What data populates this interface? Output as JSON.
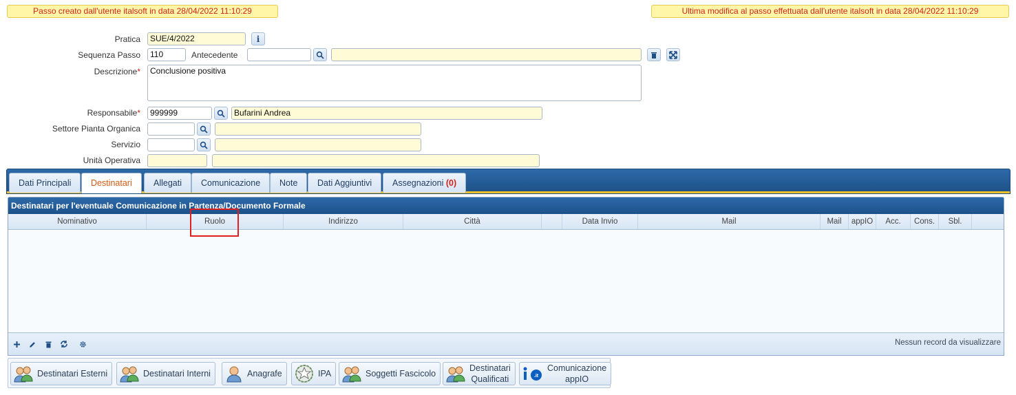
{
  "banners": {
    "created": "Passo creato dall'utente italsoft in data 28/04/2022 11:10:29",
    "modified": "Ultima modifica al passo effettuata dall'utente italsoft in data 28/04/2022 11:10:29"
  },
  "form": {
    "pratica_label": "Pratica",
    "pratica_value": "SUE/4/2022",
    "sequenza_label": "Sequenza Passo",
    "sequenza_value": "110",
    "antecedente_label": "Antecedente",
    "antecedente_value": "",
    "antecedente_desc": "",
    "descrizione_label": "Descrizione",
    "descrizione_value": "Conclusione positiva",
    "responsabile_label": "Responsabile",
    "responsabile_code": "999999",
    "responsabile_name": "Bufarini Andrea",
    "settore_label": "Settore Pianta Organica",
    "settore_code": "",
    "settore_desc": "",
    "servizio_label": "Servizio",
    "servizio_code": "",
    "servizio_desc": "",
    "unita_label": "Unità Operativa",
    "unita_code": "",
    "unita_desc": "",
    "required_mark": "*"
  },
  "tabs": [
    {
      "label": "Dati Principali"
    },
    {
      "label": "Destinatari",
      "active": true
    },
    {
      "label": "Allegati"
    },
    {
      "label": "Comunicazione"
    },
    {
      "label": "Note"
    },
    {
      "label": "Dati Aggiuntivi"
    },
    {
      "label": "Assegnazioni",
      "count": "(0)"
    }
  ],
  "grid": {
    "title": "Destinatari per l'eventuale Comunicazione in Partenza/Documento Formale",
    "columns": [
      "Nominativo",
      "Ruolo",
      "Indirizzo",
      "Città",
      "",
      "Data Invio",
      "Mail",
      "Mail",
      "appIO",
      "Acc.",
      "Cons.",
      "Sbl.",
      ""
    ],
    "rows": [],
    "empty_message": "Nessun record da visualizzare"
  },
  "actions": {
    "esterni": "Destinatari Esterni",
    "interni": "Destinatari Interni",
    "anagrafe": "Anagrafe",
    "ipa": "IPA",
    "soggetti": "Soggetti Fascicolo",
    "qualificati_1": "Destinatari",
    "qualificati_2": "Qualificati",
    "appio_1": "Comunicazione",
    "appio_2": "appIO"
  },
  "colors": {
    "accent_blue": "#1d4f84",
    "banner_bg": "#fff6a8",
    "banner_text": "#d0241b",
    "active_tab_text": "#d35a14",
    "highlight": "#e02020"
  }
}
